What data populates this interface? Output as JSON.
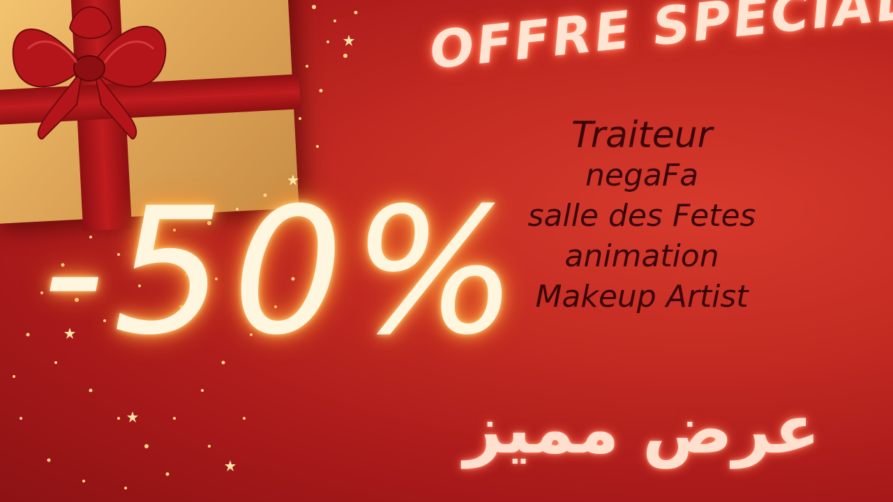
{
  "promo": {
    "headline": "OFFRE SPECIAL",
    "discount": "-50%",
    "services": [
      "Traiteur",
      "negaFa",
      "salle des Fetes",
      "animation",
      "Makeup Artist"
    ],
    "arabic_headline": "عرض مميز"
  },
  "colors": {
    "background": "#c42b22",
    "headline_glow": "#ffe4d2",
    "discount_glow": "#fff6e0",
    "service_text": "#3a0508"
  },
  "decor": {
    "gift_box": "gift-box-with-red-bow",
    "sparkles": "gold-star-sparkles"
  }
}
